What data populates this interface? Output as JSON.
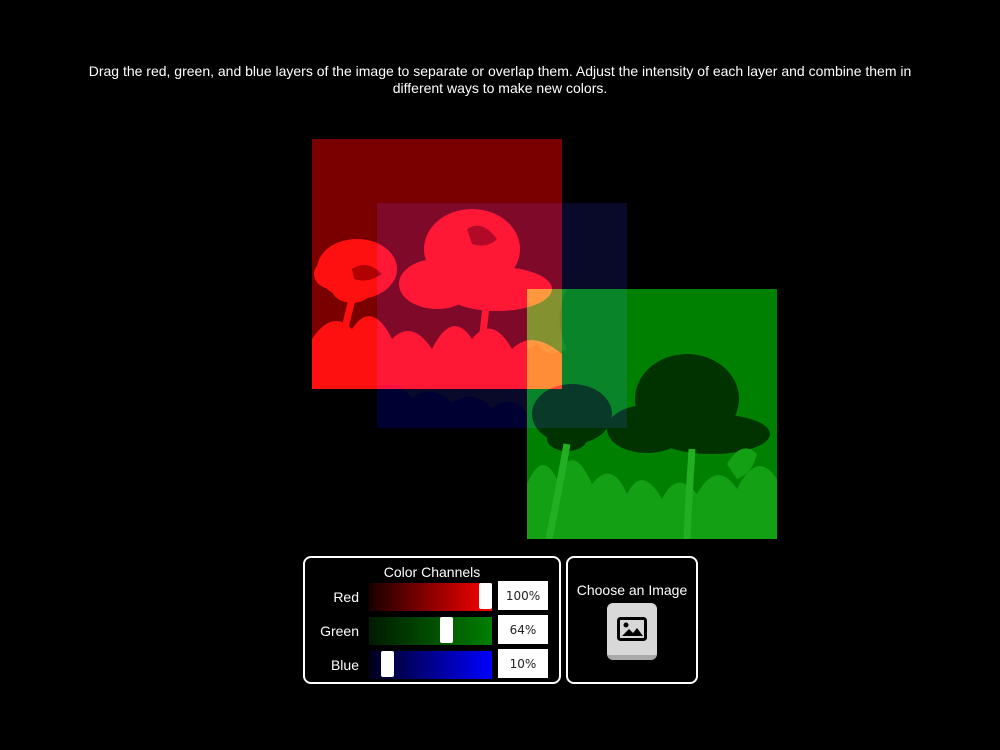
{
  "instructions": "Drag the red, green, and blue layers of the image to separate or overlap them. Adjust the intensity of each layer and combine them in different ways to make new colors.",
  "layers": [
    {
      "channel": "red",
      "color": "#ff0000"
    },
    {
      "channel": "green",
      "color": "#00ff00"
    },
    {
      "channel": "blue",
      "color": "#0000ff"
    }
  ],
  "channels_panel": {
    "title": "Color Channels",
    "channels": [
      {
        "label": "Red",
        "value": "100%",
        "fraction": 1.0,
        "gradient_from": "#1a0000",
        "gradient_to": "#ff0000"
      },
      {
        "label": "Green",
        "value": "64%",
        "fraction": 0.64,
        "gradient_from": "#001a00",
        "gradient_to": "#007f00"
      },
      {
        "label": "Blue",
        "value": "10%",
        "fraction": 0.1,
        "gradient_from": "#00001a",
        "gradient_to": "#0000ff"
      }
    ]
  },
  "image_panel": {
    "label": "Choose an Image",
    "icon": "image-icon"
  }
}
